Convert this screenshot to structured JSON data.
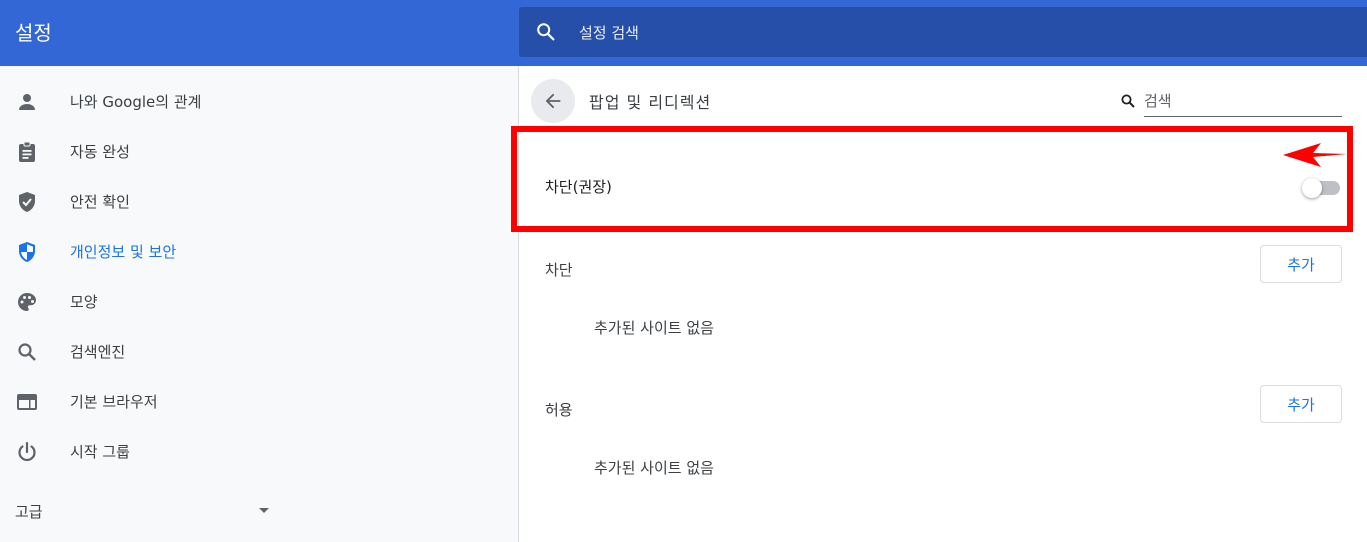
{
  "header": {
    "title": "설정",
    "search_placeholder": "설정 검색"
  },
  "sidebar": {
    "items": [
      {
        "label": "나와 Google의 관계",
        "icon": "person-icon"
      },
      {
        "label": "자동 완성",
        "icon": "clipboard-icon"
      },
      {
        "label": "안전 확인",
        "icon": "shield-check-icon"
      },
      {
        "label": "개인정보 및 보안",
        "icon": "shield-icon",
        "active": true
      },
      {
        "label": "모양",
        "icon": "palette-icon"
      },
      {
        "label": "검색엔진",
        "icon": "search-icon"
      },
      {
        "label": "기본 브라우저",
        "icon": "browser-icon"
      },
      {
        "label": "시작 그룹",
        "icon": "power-icon"
      }
    ],
    "advanced_label": "고급"
  },
  "main": {
    "page_title": "팝업 및 리디렉션",
    "search_placeholder": "검색",
    "toggle": {
      "label": "차단(권장)",
      "on": false
    },
    "blocked": {
      "title": "차단",
      "add_label": "추가",
      "empty_text": "추가된 사이트 없음"
    },
    "allowed": {
      "title": "허용",
      "add_label": "추가",
      "empty_text": "추가된 사이트 없음"
    }
  },
  "colors": {
    "header_bg": "#3367d6",
    "search_bg": "#254fa8",
    "accent": "#1a73e8",
    "highlight_red": "#ff0000"
  }
}
